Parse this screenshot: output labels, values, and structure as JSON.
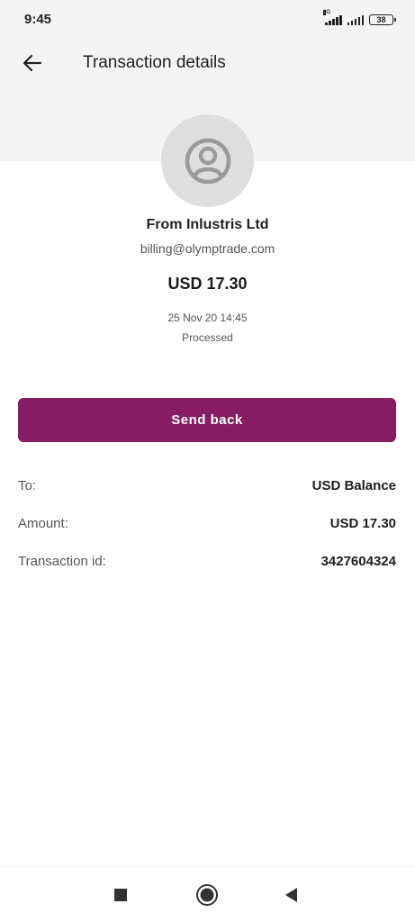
{
  "status_bar": {
    "time": "9:45",
    "network_label": "4G",
    "battery_level": "38"
  },
  "header": {
    "title": "Transaction details",
    "back_icon": "arrow-left-icon"
  },
  "transaction": {
    "avatar_icon": "user-circle-icon",
    "sender": "From Inlustris Ltd",
    "email": "billing@olymptrade.com",
    "amount": "USD 17.30",
    "date": "25 Nov 20 14:45",
    "status": "Processed"
  },
  "actions": {
    "send_back_label": "Send back"
  },
  "details": {
    "to_label": "To:",
    "to_value": "USD Balance",
    "amount_label": "Amount:",
    "amount_value": "USD 17.30",
    "id_label": "Transaction id:",
    "id_value": "3427604324"
  },
  "nav_bar": {
    "recents_icon": "square-icon",
    "home_icon": "circle-icon",
    "back_icon": "triangle-back-icon"
  },
  "colors": {
    "accent": "#861c64",
    "header_bg": "#f4f4f4",
    "avatar_bg": "#dedede"
  }
}
